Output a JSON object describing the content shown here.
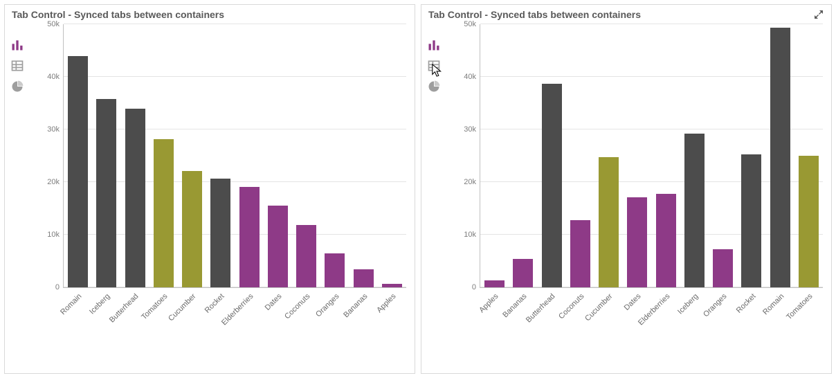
{
  "panels": [
    {
      "title": "Tab Control - Synced tabs between containers",
      "expand_visible": false
    },
    {
      "title": "Tab Control - Synced tabs between containers",
      "expand_visible": true
    }
  ],
  "side_tabs": [
    {
      "name": "bar-chart-icon",
      "active": true
    },
    {
      "name": "table-icon",
      "active": false
    },
    {
      "name": "pie-chart-icon",
      "active": false
    }
  ],
  "colors": {
    "dark": "#4C4C4C",
    "olive": "#999933",
    "purple": "#8E3A87"
  },
  "y_ticks": [
    "0",
    "10k",
    "20k",
    "30k",
    "40k",
    "50k"
  ],
  "chart_data": [
    {
      "type": "bar",
      "title": "Tab Control - Synced tabs between containers",
      "xlabel": "",
      "ylabel": "",
      "ylim": [
        0,
        50000
      ],
      "categories": [
        "Romain",
        "Iceberg",
        "Butterhead",
        "Tomatoes",
        "Cucumber",
        "Rocket",
        "Elderberries",
        "Dates",
        "Coconuts",
        "Oranges",
        "Bananas",
        "Apples"
      ],
      "values": [
        44000,
        35800,
        34000,
        28100,
        22100,
        20700,
        19100,
        15500,
        11800,
        6400,
        3400,
        600
      ],
      "palette": [
        "dark",
        "dark",
        "dark",
        "olive",
        "olive",
        "dark",
        "purple",
        "purple",
        "purple",
        "purple",
        "purple",
        "purple"
      ]
    },
    {
      "type": "bar",
      "title": "Tab Control - Synced tabs between containers",
      "xlabel": "",
      "ylabel": "",
      "ylim": [
        0,
        50000
      ],
      "categories": [
        "Apples",
        "Bananas",
        "Butterhead",
        "Coconuts",
        "Cucumber",
        "Dates",
        "Elderberries",
        "Iceberg",
        "Oranges",
        "Rocket",
        "Romain",
        "Tomatoes"
      ],
      "values": [
        1300,
        5400,
        38700,
        12800,
        24700,
        17100,
        17700,
        29200,
        7200,
        25200,
        49400,
        25000
      ],
      "palette": [
        "purple",
        "purple",
        "dark",
        "purple",
        "olive",
        "purple",
        "purple",
        "dark",
        "purple",
        "dark",
        "dark",
        "olive"
      ]
    }
  ]
}
